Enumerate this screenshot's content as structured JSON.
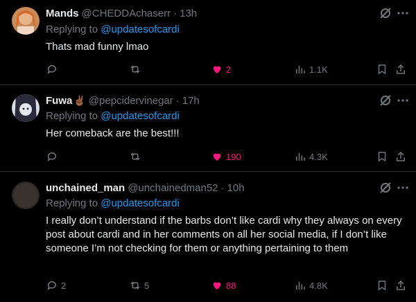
{
  "tweets": [
    {
      "name": "Mands",
      "handle": "@CHEDDAchaserr",
      "time": "13h",
      "replying_prefix": "Replying to",
      "replying_to": "@updatesofcardi",
      "text": "Thats mad funny lmao",
      "replies": "",
      "retweets": "",
      "likes": "2",
      "views": "1.1K"
    },
    {
      "name": "Fuwa",
      "name_emoji": "✌🏾",
      "handle": "@pepcidervinegar",
      "time": "17h",
      "replying_prefix": "Replying to",
      "replying_to": "@updatesofcardi",
      "text": "Her comeback are the best!!!",
      "replies": "",
      "retweets": "",
      "likes": "190",
      "views": "4.3K"
    },
    {
      "name": "unchained_man",
      "handle": "@unchainedman52",
      "time": "10h",
      "replying_prefix": "Replying to",
      "replying_to": "@updatesofcardi",
      "text": "I really don’t understand if the barbs don’t like cardi why they always on every post about cardi and in her comments on all her social media, if I don’t like someone I’m not checking for them or anything pertaining to them",
      "replies": "2",
      "retweets": "5",
      "likes": "88",
      "views": "4.8K"
    }
  ],
  "separator": "·",
  "colors": {
    "background": "#000000",
    "text": "#e7e9ea",
    "secondary": "#71767b",
    "link": "#1d9bf0",
    "like": "#f91880",
    "divider": "#2f3336"
  },
  "icons": [
    "grok-icon",
    "more-icon",
    "reply-icon",
    "retweet-icon",
    "heart-filled-icon",
    "views-icon",
    "bookmark-icon",
    "share-icon"
  ]
}
